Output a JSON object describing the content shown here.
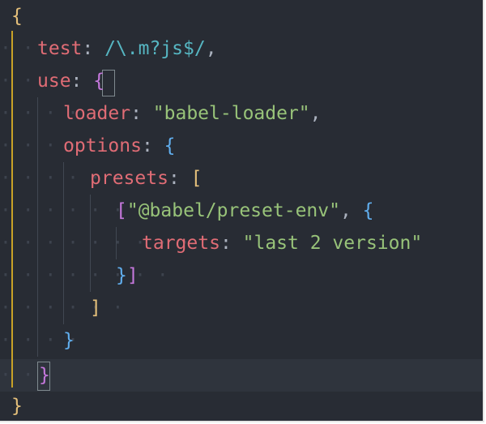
{
  "editor": {
    "lines": [
      {
        "tokens": [
          {
            "text": "{",
            "color": "#e5c07b"
          }
        ]
      },
      {
        "tokens": [
          {
            "text": "test",
            "color": "#e06c75"
          },
          {
            "text": ": ",
            "color": "#abb2bf"
          },
          {
            "text": "/\\.m?js$/",
            "color": "#56b6c2"
          },
          {
            "text": ",",
            "color": "#abb2bf"
          }
        ]
      },
      {
        "tokens": [
          {
            "text": "use",
            "color": "#e06c75"
          },
          {
            "text": ": ",
            "color": "#abb2bf"
          },
          {
            "text": "{",
            "color": "#c678dd"
          }
        ]
      },
      {
        "tokens": [
          {
            "text": "loader",
            "color": "#e06c75"
          },
          {
            "text": ": ",
            "color": "#abb2bf"
          },
          {
            "text": "\"babel-loader\"",
            "color": "#98c379"
          },
          {
            "text": ",",
            "color": "#abb2bf"
          }
        ]
      },
      {
        "tokens": [
          {
            "text": "options",
            "color": "#e06c75"
          },
          {
            "text": ": ",
            "color": "#abb2bf"
          },
          {
            "text": "{",
            "color": "#61afef"
          }
        ]
      },
      {
        "tokens": [
          {
            "text": "presets",
            "color": "#e06c75"
          },
          {
            "text": ": ",
            "color": "#abb2bf"
          },
          {
            "text": "[",
            "color": "#e5c07b"
          }
        ]
      },
      {
        "tokens": [
          {
            "text": "[",
            "color": "#c678dd"
          },
          {
            "text": "\"@babel/preset-env\"",
            "color": "#98c379"
          },
          {
            "text": ", ",
            "color": "#abb2bf"
          },
          {
            "text": "{",
            "color": "#61afef"
          }
        ]
      },
      {
        "tokens": [
          {
            "text": "targets",
            "color": "#e06c75"
          },
          {
            "text": ": ",
            "color": "#abb2bf"
          },
          {
            "text": "\"last 2 version\"",
            "color": "#98c379"
          }
        ]
      },
      {
        "tokens": [
          {
            "text": "}",
            "color": "#61afef"
          },
          {
            "text": "]",
            "color": "#c678dd"
          }
        ]
      },
      {
        "tokens": [
          {
            "text": "]",
            "color": "#e5c07b"
          }
        ]
      },
      {
        "tokens": [
          {
            "text": "}",
            "color": "#61afef"
          }
        ]
      },
      {
        "tokens": [
          {
            "text": "}",
            "color": "#c678dd"
          }
        ]
      },
      {
        "tokens": [
          {
            "text": "}",
            "color": "#e5c07b"
          }
        ]
      }
    ]
  }
}
